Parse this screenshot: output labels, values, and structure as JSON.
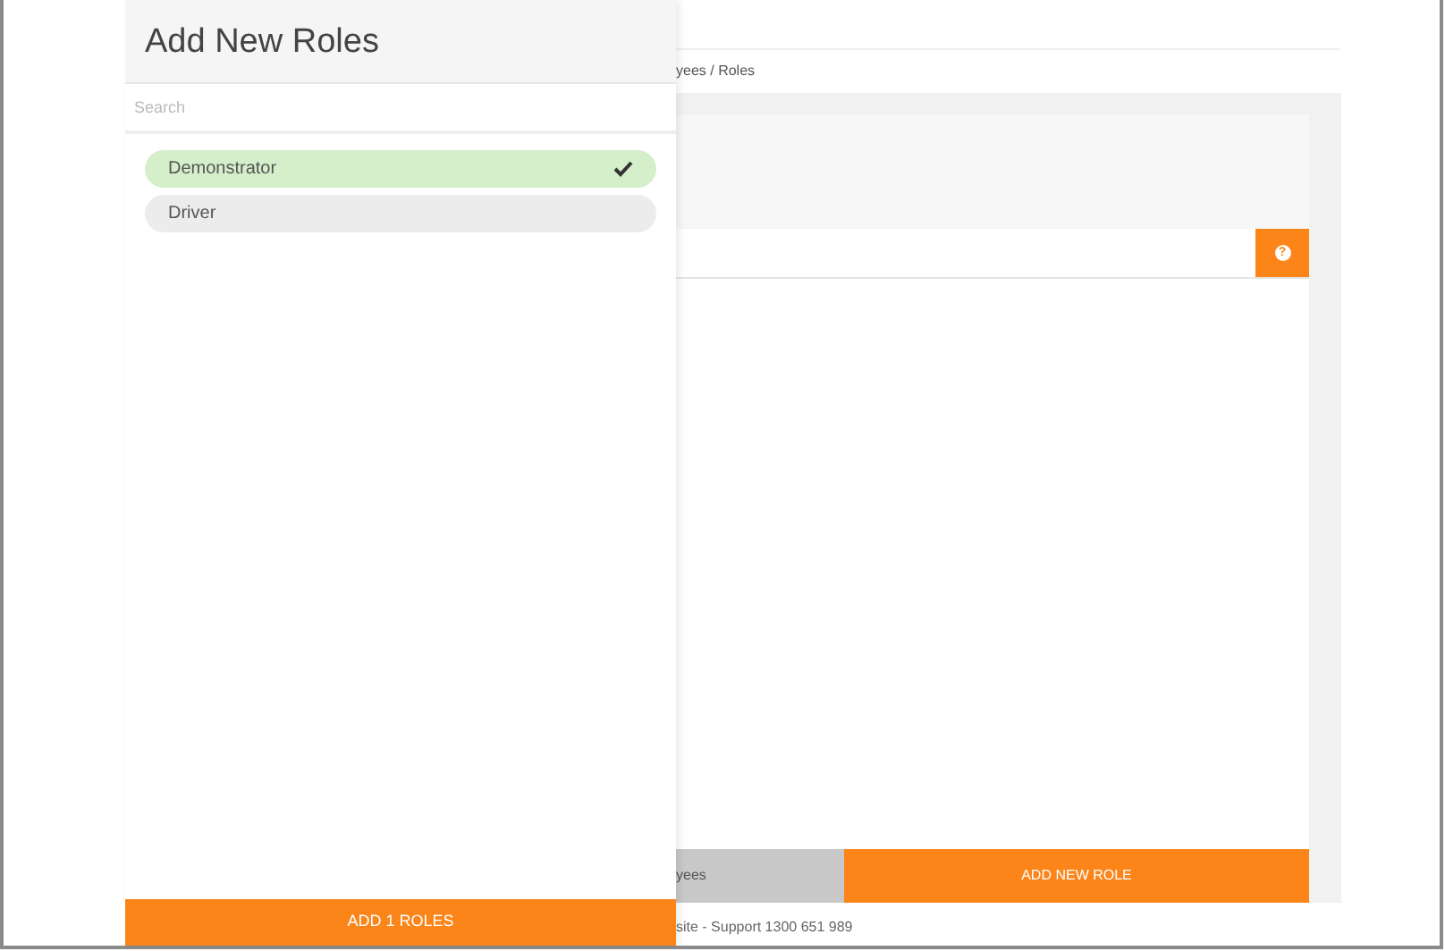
{
  "panel": {
    "title": "Add New Roles",
    "search": {
      "placeholder": "Search"
    },
    "roles": [
      {
        "label": "Demonstrator",
        "selected": true
      },
      {
        "label": "Driver",
        "selected": false
      }
    ],
    "submit": "ADD 1 ROLES"
  },
  "page": {
    "breadcrumb": "yees / Roles",
    "help": "?",
    "buttons": [
      {
        "label": "yees",
        "kind": "secondary"
      },
      {
        "label": "ADD NEW ROLE",
        "kind": "primary"
      }
    ],
    "footer": "site - Support 1300 651 989"
  }
}
